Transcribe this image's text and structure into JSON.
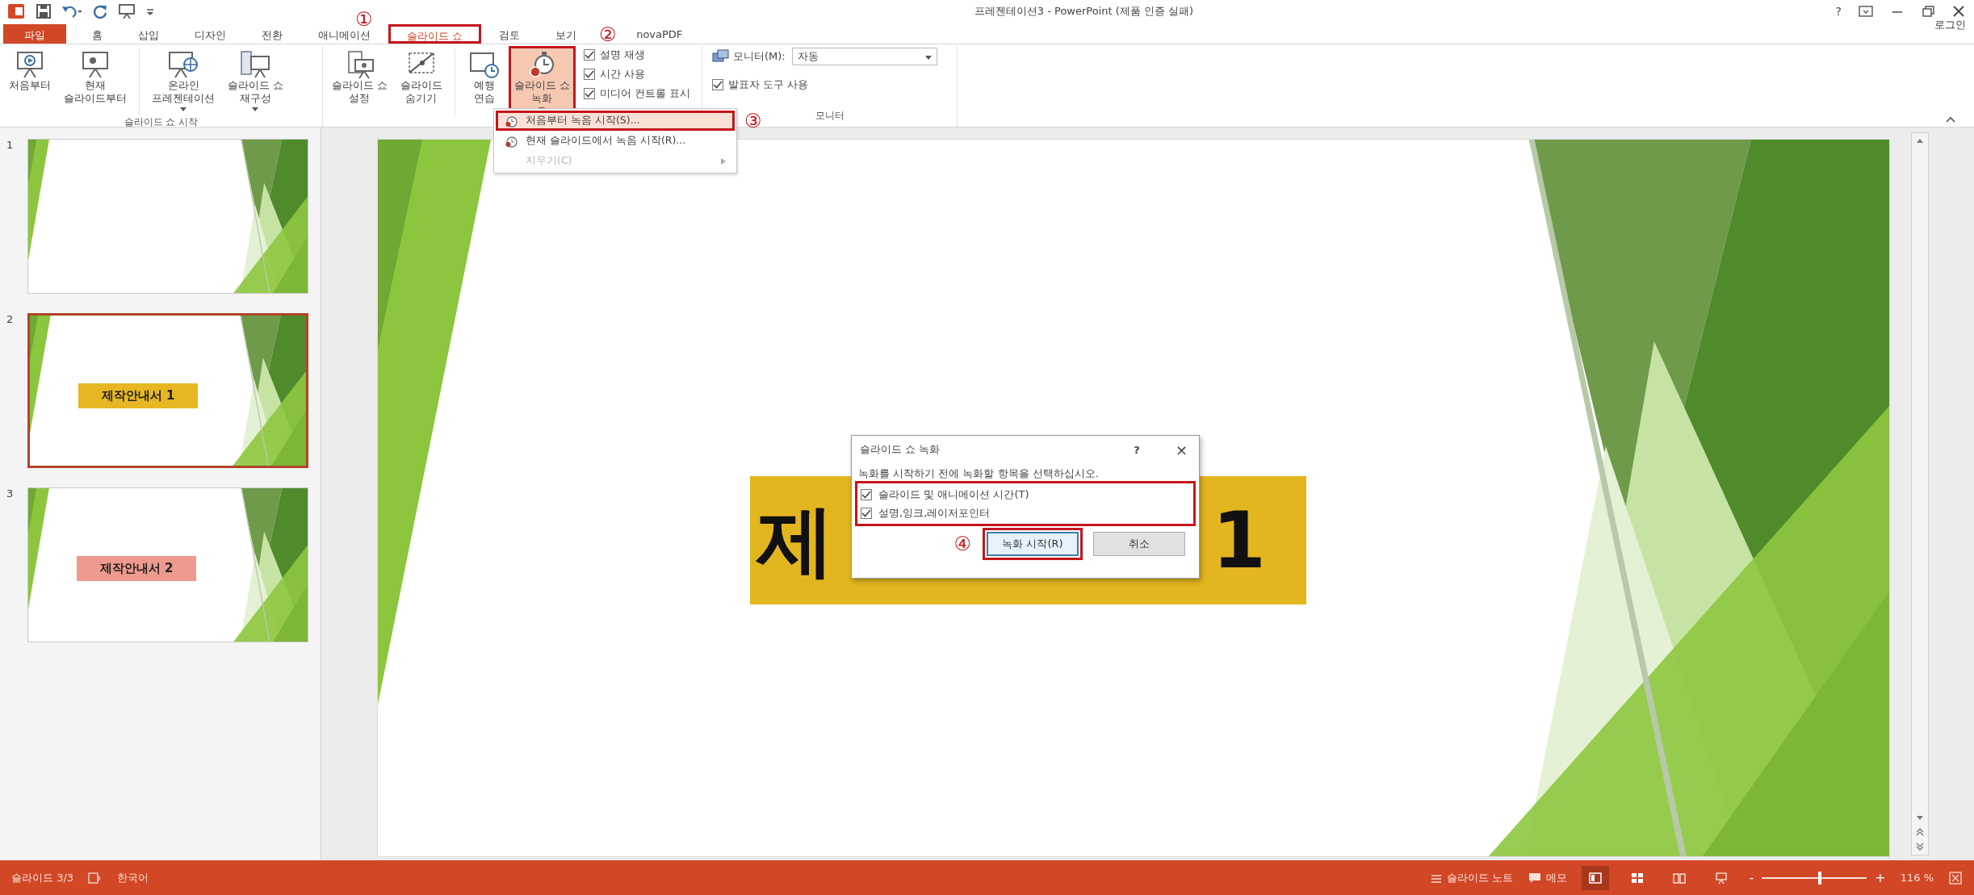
{
  "window": {
    "title": "프레젠테이션3 - PowerPoint (제품 인증 실패)",
    "help": "?",
    "sign_in": "로그인"
  },
  "tabs": [
    {
      "label": "파일",
      "kind": "file",
      "selected": false,
      "highlighted": false
    },
    {
      "label": "홈",
      "kind": "tab",
      "selected": false,
      "highlighted": false
    },
    {
      "label": "삽입",
      "kind": "tab",
      "selected": false,
      "highlighted": false
    },
    {
      "label": "디자인",
      "kind": "tab",
      "selected": false,
      "highlighted": false
    },
    {
      "label": "전환",
      "kind": "tab",
      "selected": false,
      "highlighted": false
    },
    {
      "label": "애니메이션",
      "kind": "tab",
      "selected": false,
      "highlighted": false
    },
    {
      "label": "슬라이드 쇼",
      "kind": "tab",
      "selected": true,
      "highlighted": true
    },
    {
      "label": "검토",
      "kind": "tab",
      "selected": false,
      "highlighted": false
    },
    {
      "label": "보기",
      "kind": "tab",
      "selected": false,
      "highlighted": false
    },
    {
      "label": "novaPDF",
      "kind": "tab",
      "selected": false,
      "highlighted": false
    }
  ],
  "ribbon": {
    "groups": [
      {
        "label": "슬라이드 쇼 시작",
        "buttons": [
          {
            "label": "처음부터",
            "has_menu": false,
            "pressed": false,
            "highlighted": false
          },
          {
            "label": "현재\n슬라이드부터",
            "has_menu": false,
            "pressed": false,
            "highlighted": false
          },
          {
            "label": "온라인\n프레젠테이션",
            "has_menu": true,
            "pressed": false,
            "highlighted": false
          },
          {
            "label": "슬라이드 쇼\n재구성",
            "has_menu": true,
            "pressed": false,
            "highlighted": false
          }
        ]
      },
      {
        "buttons": [
          {
            "label": "슬라이드 쇼\n설정",
            "has_menu": false,
            "pressed": false,
            "highlighted": false
          },
          {
            "label": "슬라이드\n숨기기",
            "has_menu": false,
            "pressed": false,
            "highlighted": false
          },
          {
            "label": "예행\n연습",
            "has_menu": false,
            "pressed": false,
            "highlighted": false
          },
          {
            "label": "슬라이드 쇼\n녹화",
            "has_menu": true,
            "pressed": true,
            "highlighted": true
          }
        ],
        "checkboxes": [
          {
            "label": "설명 재생",
            "checked": true
          },
          {
            "label": "시간 사용",
            "checked": true
          },
          {
            "label": "미디어 컨트롤 표시",
            "checked": true
          }
        ]
      },
      {
        "label": "모니터",
        "monitor": {
          "label": "모니터(M):",
          "value": "자동"
        },
        "checkboxes": [
          {
            "label": "발표자 도구 사용",
            "checked": true
          }
        ]
      }
    ]
  },
  "record_menu": {
    "items": [
      {
        "label": "처음부터 녹음 시작(S)...",
        "selected": true,
        "disabled": false,
        "submenu": false,
        "highlighted": true
      },
      {
        "label": "현재 슬라이드에서 녹음 시작(R)...",
        "selected": false,
        "disabled": false,
        "submenu": false,
        "highlighted": false
      },
      {
        "label": "지우기(C)",
        "selected": false,
        "disabled": true,
        "submenu": true,
        "highlighted": false
      }
    ]
  },
  "thumbnails": [
    {
      "number": "1",
      "selected": false
    },
    {
      "number": "2",
      "selected": true,
      "title": "제작안내서 1",
      "color": "#e6b722"
    },
    {
      "number": "3",
      "selected": false,
      "title": "제작안내서 2",
      "color": "#ee9a8e"
    }
  ],
  "slide": {
    "title_parts": [
      "제",
      "1"
    ]
  },
  "dialog": {
    "title": "슬라이드 쇼 녹화",
    "help": "?",
    "close": "×",
    "message": "녹화를 시작하기 전에 녹화할 항목을 선택하십시오.",
    "options_highlighted": true,
    "options": [
      {
        "label": "슬라이드 및 애니메이션 시간(T)",
        "checked": true
      },
      {
        "label": "설명,잉크,레이저포인터",
        "checked": true
      }
    ],
    "buttons": [
      {
        "label": "녹화 시작(R)",
        "default": true,
        "highlighted": true
      },
      {
        "label": "취소",
        "default": false,
        "highlighted": false
      }
    ]
  },
  "annotations": [
    {
      "label": "①"
    },
    {
      "label": "②"
    },
    {
      "label": "③"
    },
    {
      "label": "④"
    }
  ],
  "status_bar": {
    "slide": "슬라이드 3/3",
    "language": "한국어",
    "notes": "슬라이드 노트",
    "comments": "메모",
    "views": [
      {
        "selected": true
      },
      {
        "selected": false
      },
      {
        "selected": false
      },
      {
        "selected": false
      }
    ],
    "zoom_out": "-",
    "zoom_in": "+",
    "zoom": {
      "level": 0.55
    },
    "zoom_reading": "116 %"
  }
}
